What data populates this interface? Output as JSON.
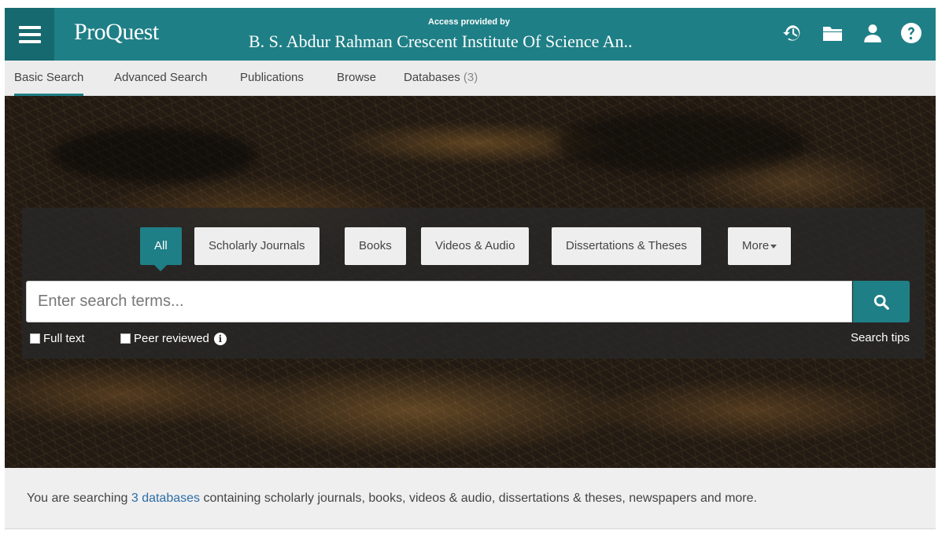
{
  "header": {
    "logo": "ProQuest",
    "access_label": "Access provided by",
    "institution": "B. S. Abdur Rahman Crescent Institute Of Science An..",
    "icons": [
      "menu-icon",
      "history-icon",
      "folder-icon",
      "user-icon",
      "help-icon"
    ]
  },
  "nav": {
    "tabs": [
      {
        "label": "Basic Search"
      },
      {
        "label": "Advanced Search"
      },
      {
        "label": "Publications"
      },
      {
        "label": "Browse"
      },
      {
        "label": "Databases",
        "count": "(3)"
      }
    ],
    "active": "Basic Search"
  },
  "search": {
    "filters": [
      {
        "label": "All"
      },
      {
        "label": "Scholarly Journals"
      },
      {
        "label": "Books"
      },
      {
        "label": "Videos & Audio"
      },
      {
        "label": "Dissertations & Theses"
      },
      {
        "label": "More"
      }
    ],
    "active_filter": "All",
    "placeholder": "Enter search terms...",
    "value": "",
    "full_text_label": "Full text",
    "peer_reviewed_label": "Peer reviewed",
    "info_glyph": "i",
    "tips_label": "Search tips"
  },
  "footer_info": {
    "prefix": "You are searching ",
    "link": "3 databases",
    "suffix": " containing scholarly journals, books, videos & audio, dissertations & theses, newspapers and more."
  },
  "colors": {
    "brand": "#1f7f86",
    "brand_dark": "#16696f",
    "nav_bg": "#ececec",
    "link": "#2d6da8"
  }
}
